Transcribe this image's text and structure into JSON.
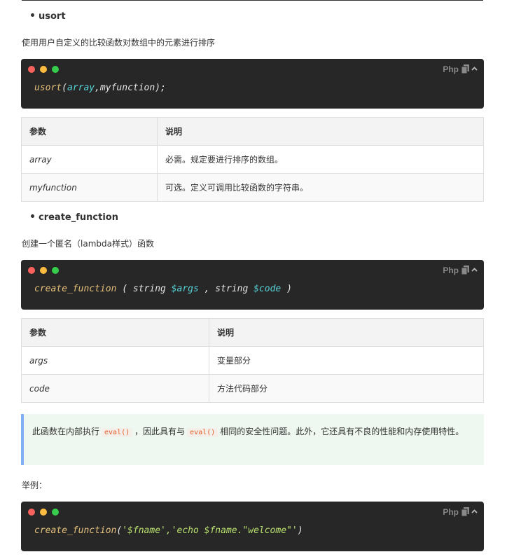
{
  "sections": [
    {
      "heading": "usort",
      "description": "使用用户自定义的比较函数对数组中的元素进行排序",
      "code": {
        "lang": "Php",
        "tokens": [
          "usort",
          "(",
          "array",
          ",myfunction);"
        ]
      },
      "table": {
        "headers": [
          "参数",
          "说明"
        ],
        "rows": [
          [
            "array",
            "必需。规定要进行排序的数组。"
          ],
          [
            "myfunction",
            "可选。定义可调用比较函数的字符串。"
          ]
        ]
      }
    },
    {
      "heading": "create_function",
      "description": "创建一个匿名（lambda样式）函数",
      "code": {
        "lang": "Php",
        "tokens": [
          "create_function",
          " ( string ",
          "$args",
          " , string ",
          "$code",
          " )"
        ]
      },
      "table": {
        "headers": [
          "参数",
          "说明"
        ],
        "rows": [
          [
            "args",
            "变量部分"
          ],
          [
            "code",
            "方法代码部分"
          ]
        ]
      }
    }
  ],
  "note": {
    "part1": "此函数在内部执行",
    "code1": "eval()",
    "part2": "，因此具有与",
    "code2": "eval()",
    "part3": "相同的安全性问题。此外，它还具有不良的性能和内存使用特性。"
  },
  "example": {
    "label": "举例：",
    "code": {
      "lang": "Php",
      "tokens": [
        "create_function",
        "(",
        "'$fname','echo $fname.\"welcome\"'",
        ")"
      ]
    }
  },
  "colors": {
    "code_bg": "#272727",
    "function_name": "#e5c07b",
    "variable": "#56d2d6",
    "string": "#b8e06c",
    "note_bg": "#eef8f1",
    "note_border": "#7fb0f2",
    "inline_code": "#e35d28"
  },
  "icons": [
    "red-dot",
    "yellow-dot",
    "green-dot",
    "copy-icon",
    "chevron-up-icon"
  ]
}
